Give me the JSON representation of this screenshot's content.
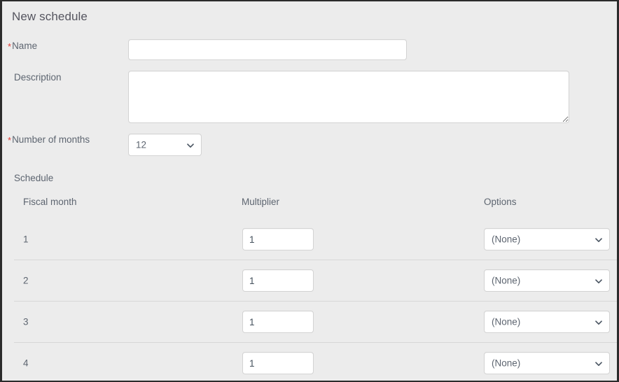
{
  "window": {
    "background_color": "#ececec",
    "border_color": "#2b2b2b"
  },
  "form": {
    "title": "New schedule",
    "required_marker": "*",
    "fields": {
      "name": {
        "label": "Name",
        "required": true,
        "value": "",
        "placeholder": ""
      },
      "description": {
        "label": "Description",
        "required": false,
        "value": "",
        "placeholder": ""
      },
      "number_of_months": {
        "label": "Number of months",
        "required": true,
        "selected": "12",
        "options": [
          "12"
        ]
      }
    }
  },
  "schedule": {
    "section_label": "Schedule",
    "columns": [
      "Fiscal month",
      "Multiplier",
      "Options"
    ],
    "rows": [
      {
        "fiscal_month": "1",
        "multiplier": "1",
        "option": "(None)"
      },
      {
        "fiscal_month": "2",
        "multiplier": "1",
        "option": "(None)"
      },
      {
        "fiscal_month": "3",
        "multiplier": "1",
        "option": "(None)"
      },
      {
        "fiscal_month": "4",
        "multiplier": "1",
        "option": "(None)"
      }
    ],
    "option_choices": [
      "(None)"
    ]
  },
  "colors": {
    "label_text": "#5d6570",
    "title_text": "#55555f",
    "required_star": "#e23c34",
    "input_border": "#d3d3d3",
    "row_divider": "#d7d7d7",
    "input_background": "#ffffff"
  },
  "icons": {
    "chevron_down": "chevron-down-icon",
    "resize_grip": "resize-grip-icon"
  }
}
